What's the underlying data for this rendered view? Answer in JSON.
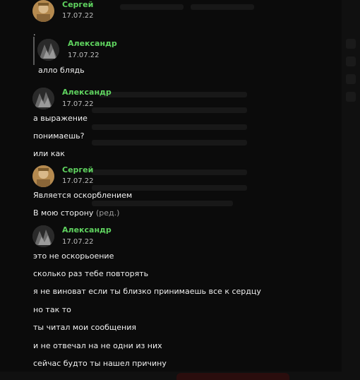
{
  "messages": [
    {
      "author": "Сергей",
      "date": "17.07.22"
    },
    {
      "text": "."
    },
    {
      "quoted_author": "Александр",
      "quoted_date": "17.07.22",
      "quoted_text": "алло блядь"
    },
    {
      "author": "Александр",
      "date": "17.07.22"
    },
    {
      "text": "а выражение"
    },
    {
      "text": "понимаешь?"
    },
    {
      "text": "или как"
    },
    {
      "author": "Сергей",
      "date": "17.07.22"
    },
    {
      "text": "Является оскорблением"
    },
    {
      "text": "В мою сторону",
      "edited": "(ред.)"
    },
    {
      "author": "Александр",
      "date": "17.07.22"
    },
    {
      "text": "это не оскорьоение"
    },
    {
      "text": "сколько раз тебе повторять"
    },
    {
      "text": "я не виноват если ты близко принимаешь все к сердцу"
    },
    {
      "text": "но так то"
    },
    {
      "text": "ты читал мои сообщения"
    },
    {
      "text": "и не отвечал на не одни из них"
    },
    {
      "text": "сейчас будто ты нашел причину"
    }
  ],
  "colors": {
    "author_name": "#5fd35f",
    "background": "#0b0b0b",
    "text": "#f0f0f0"
  },
  "icons": [
    "avatar-sergey",
    "avatar-alexandr"
  ]
}
